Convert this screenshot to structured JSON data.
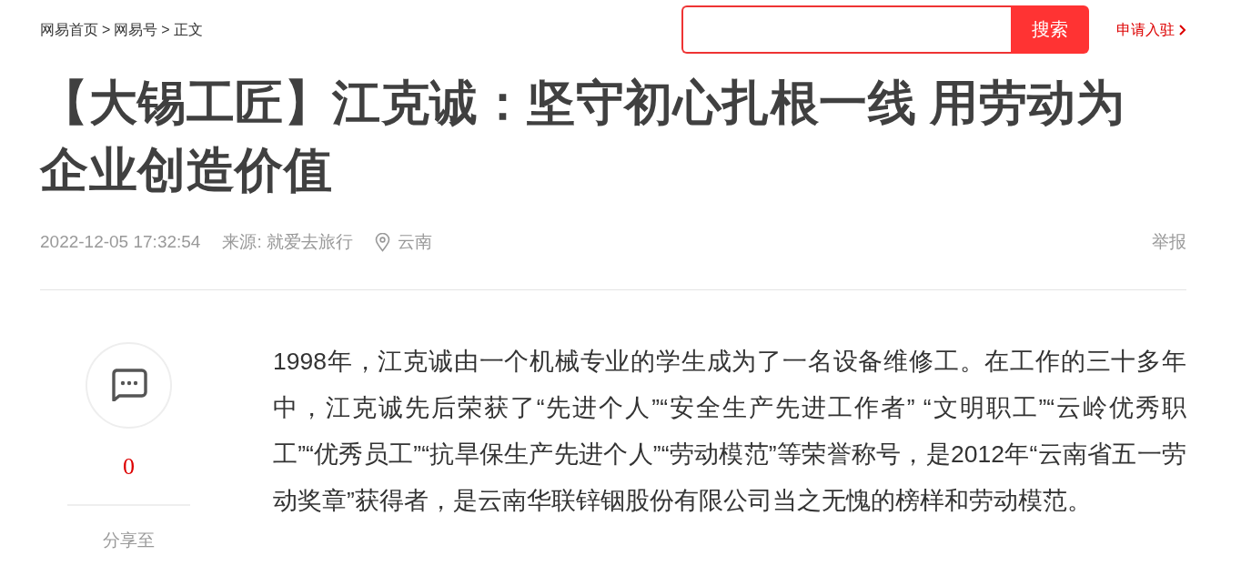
{
  "breadcrumb": [
    {
      "label": "网易首页"
    },
    {
      "label": "网易号"
    },
    {
      "label": "正文"
    }
  ],
  "breadcrumb_separator": ">",
  "search": {
    "button": "搜索"
  },
  "apply_link": "申请入驻",
  "title": "【大锡工匠】江克诚：坚守初心扎根一线 用劳动为企业创造价值",
  "meta": {
    "datetime": "2022-12-05 17:32:54",
    "source": "来源: 就爱去旅行",
    "location": "云南",
    "report": "举报"
  },
  "sidebar": {
    "comment_count": "0",
    "share_label": "分享至"
  },
  "paragraphs": [
    "1998年，江克诚由一个机械专业的学生成为了一名设备维修工。在工作的三十多年中，江克诚先后荣获了“先进个人”“安全生产先进工作者” “文明职工”“云岭优秀职工”“优秀员工”“抗旱保生产先进个人”“劳动模范”等荣誉称号，是2012年“云南省五一劳动奖章”获得者，是云南华联锌铟股份有限公司当之无愧的榜样和劳动模范。"
  ]
}
